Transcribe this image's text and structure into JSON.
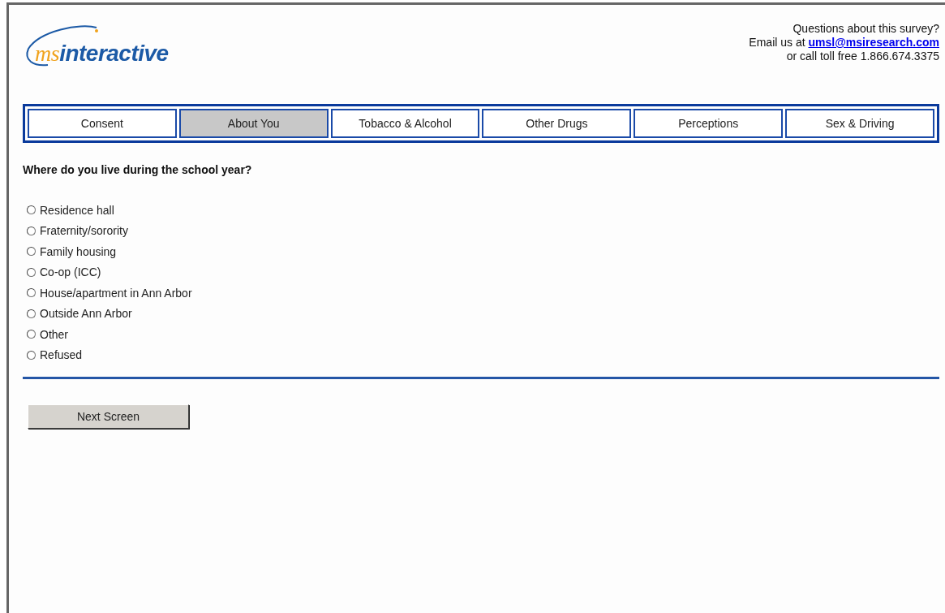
{
  "logo": {
    "prefix": "ms",
    "name": "interactive"
  },
  "contact": {
    "line1": "Questions about this survey?",
    "email_prefix": "Email us at ",
    "email": "umsl@msiresearch.com",
    "line3": "or call toll free 1.866.674.3375"
  },
  "tabs": [
    {
      "label": "Consent",
      "selected": false
    },
    {
      "label": "About You",
      "selected": true
    },
    {
      "label": "Tobacco & Alcohol",
      "selected": false
    },
    {
      "label": "Other Drugs",
      "selected": false
    },
    {
      "label": "Perceptions",
      "selected": false
    },
    {
      "label": "Sex & Driving",
      "selected": false
    }
  ],
  "question": "Where do you live during the school year?",
  "options": [
    {
      "label": "Residence hall",
      "selected": false
    },
    {
      "label": "Fraternity/sorority",
      "selected": false
    },
    {
      "label": "Family housing",
      "selected": false
    },
    {
      "label": "Co-op (ICC)",
      "selected": false
    },
    {
      "label": "House/apartment in Ann Arbor",
      "selected": false
    },
    {
      "label": "Outside Ann Arbor",
      "selected": false
    },
    {
      "label": "Other",
      "selected": false
    },
    {
      "label": "Refused",
      "selected": false
    }
  ],
  "next_button": "Next Screen"
}
